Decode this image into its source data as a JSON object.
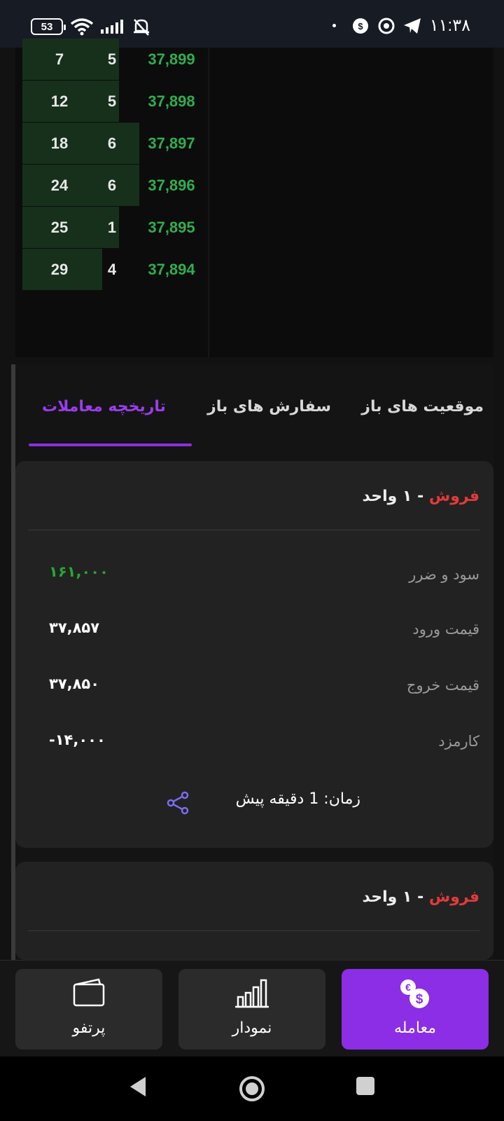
{
  "status_bar": {
    "battery": "53",
    "time": "۱۱:۳۸"
  },
  "order_book": {
    "rows": [
      {
        "total": "7",
        "qty": "5",
        "price": "37,899",
        "depth": 0.52
      },
      {
        "total": "12",
        "qty": "5",
        "price": "37,898",
        "depth": 0.52
      },
      {
        "total": "18",
        "qty": "6",
        "price": "37,897",
        "depth": 0.63
      },
      {
        "total": "24",
        "qty": "6",
        "price": "37,896",
        "depth": 0.63
      },
      {
        "total": "25",
        "qty": "1",
        "price": "37,895",
        "depth": 0.52
      },
      {
        "total": "29",
        "qty": "4",
        "price": "37,894",
        "depth": 0.43
      }
    ]
  },
  "tabs": {
    "positions": "موقعیت های باز",
    "orders": "سفارش های باز",
    "history": "تاریخچه معاملات"
  },
  "trades": [
    {
      "side": "فروش",
      "rest": " - ۱ واحد",
      "pnl_label": "سود و ضرر",
      "pnl_value": "۱۶۱,۰۰۰",
      "entry_label": "قیمت ورود",
      "entry_value": "۳۷,۸۵۷",
      "exit_label": "قیمت خروج",
      "exit_value": "۳۷,۸۵۰",
      "fee_label": "کارمزد",
      "fee_value": "-۱۴,۰۰۰",
      "time": "زمان: 1 دقیقه پیش"
    },
    {
      "side": "فروش",
      "rest": " - ۱ واحد"
    }
  ],
  "bottom_nav": {
    "portfolio": "پرتفو",
    "chart": "نمودار",
    "trade": "معامله"
  },
  "colors": {
    "accent": "#8b2ee6",
    "sell": "#e23a3a",
    "profit": "#25a834",
    "bid_price": "#2fae4e"
  }
}
